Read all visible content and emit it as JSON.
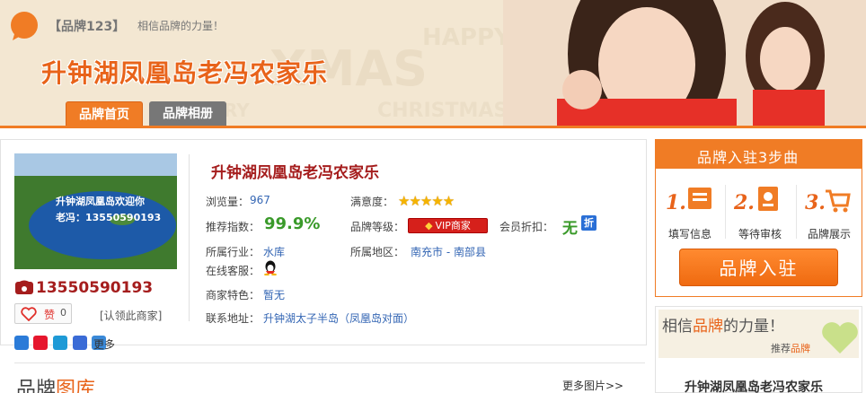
{
  "header": {
    "brand_tag": "【品牌123】",
    "slogan": "相信品牌的力量！",
    "site_title": "升钟湖凤凰岛老冯农家乐",
    "tabs": [
      {
        "label": "品牌首页",
        "active": true
      },
      {
        "label": "品牌相册",
        "active": false
      }
    ]
  },
  "shop": {
    "photo_caption_1": "升钟湖凤凰岛欢迎你",
    "photo_caption_2": "老冯：13550590193",
    "phone": "13550590193",
    "like_label": "赞",
    "like_count": "0",
    "claim_label": "[认领此商家]",
    "share_more": "更多"
  },
  "info": {
    "title": "升钟湖凤凰岛老冯农家乐",
    "views_label": "浏览量：",
    "views_value": "967",
    "satisfaction_label": "满意度：",
    "satisfaction_stars": 5,
    "recommend_label": "推荐指数：",
    "recommend_value": "99.9%",
    "level_label": "品牌等级：",
    "level_value": "VIP商家",
    "discount_label": "会员折扣：",
    "discount_value": "无",
    "discount_icon": "折",
    "industry_label": "所属行业：",
    "industry_value": "水库",
    "region_label": "所属地区：",
    "region_value": "南充市 - 南部县",
    "service_label": "在线客服：",
    "feature_label": "商家特色：",
    "feature_value": "暂无",
    "address_label": "联系地址：",
    "address_value": "升钟湖太子半岛（凤凰岛对面）"
  },
  "gallery": {
    "title_a": "品牌",
    "title_b": "图库",
    "more_label": "更多图片>>"
  },
  "sidebar": {
    "steps_title": "品牌入驻3步曲",
    "steps": [
      {
        "num": "1.",
        "label": "填写信息"
      },
      {
        "num": "2.",
        "label": "等待审核"
      },
      {
        "num": "3.",
        "label": "品牌展示"
      }
    ],
    "join_button": "品牌入驻",
    "trust_a": "相信",
    "trust_b": "品牌",
    "trust_c": "的力量！",
    "trust_sub_a": "推荐",
    "trust_sub_b": "品牌",
    "trust_name": "升钟湖凤凰岛老冯农家乐"
  },
  "colors": {
    "accent": "#f07c25",
    "title_red": "#a51d1d",
    "link_blue": "#3466b4",
    "green": "#3a9a2a"
  }
}
